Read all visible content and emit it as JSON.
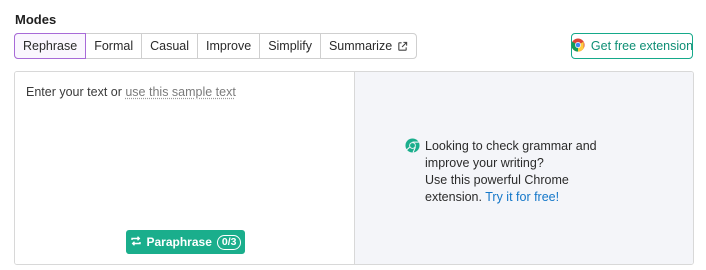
{
  "modes": {
    "title": "Modes",
    "items": [
      {
        "label": "Rephrase",
        "active": true
      },
      {
        "label": "Formal"
      },
      {
        "label": "Casual"
      },
      {
        "label": "Improve"
      },
      {
        "label": "Simplify"
      },
      {
        "label": "Summarize",
        "icon": "external-link-icon"
      }
    ]
  },
  "extension_button": {
    "label": "Get free extension",
    "icon": "chrome-icon"
  },
  "editor": {
    "prompt": "Enter your text or",
    "sample_link": "use this sample text"
  },
  "paraphrase_button": {
    "label": "Paraphrase",
    "counter": "0/3",
    "icon": "repeat-icon"
  },
  "promo": {
    "icon": "chrome-icon",
    "line1": "Looking to check grammar and",
    "line2": "improve your writing?",
    "line3": "Use this powerful Chrome",
    "line4": "extension.",
    "link": "Try it for free!"
  },
  "colors": {
    "accent_green": "#1aae8c",
    "active_mode_border": "#a86ad8",
    "link_blue": "#1477c9",
    "right_panel_bg": "#f4f5f9"
  }
}
